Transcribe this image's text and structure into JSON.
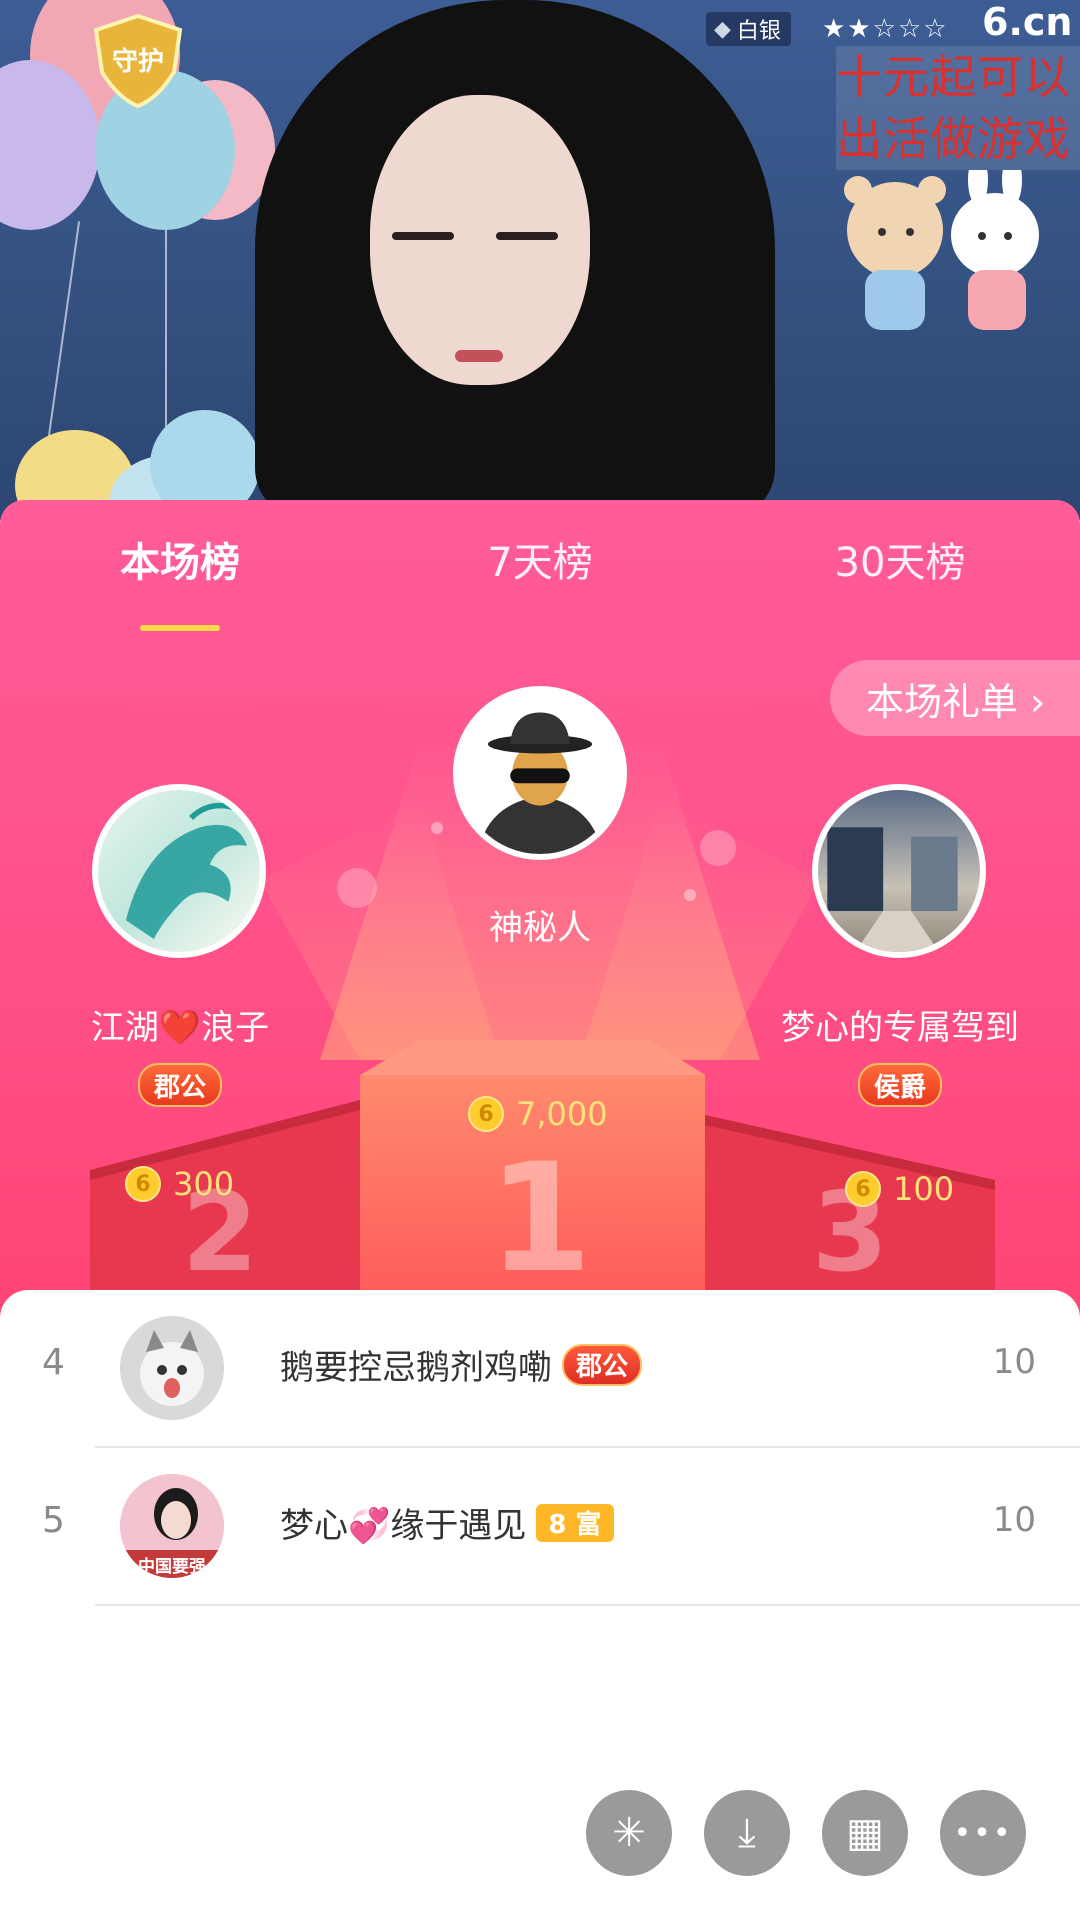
{
  "stream": {
    "guard_badge": "守护",
    "rank_label": "白银",
    "stars": "★★☆☆☆",
    "site_logo": "6.cn",
    "promo_line1": "十元起可以",
    "promo_line2": "出活做游戏"
  },
  "tabs": [
    {
      "label": "本场榜",
      "active": true
    },
    {
      "label": "7天榜",
      "active": false
    },
    {
      "label": "30天榜",
      "active": false
    }
  ],
  "gift_list_button": "本场礼单 ›",
  "podium": {
    "first": {
      "name": "神秘人",
      "score": "7,000",
      "number": "1"
    },
    "second": {
      "name": "江湖❤️浪子",
      "badge": "郡公",
      "score": "300",
      "number": "2"
    },
    "third": {
      "name": "梦心的专属驾到",
      "badge": "侯爵",
      "score": "100",
      "number": "3"
    }
  },
  "coin_glyph": "6",
  "list": [
    {
      "rank": "4",
      "name": "鹅要控忌鹅剂鸡嘞",
      "badge": "郡公",
      "badge_style": "red",
      "score": "10"
    },
    {
      "rank": "5",
      "name": "梦心💞缘于遇见",
      "badge": "8 富",
      "badge_style": "yellow",
      "score": "10",
      "avatar_text": "中国要强"
    }
  ],
  "fabs": [
    {
      "name": "share-icon",
      "glyph": "✳"
    },
    {
      "name": "download-icon",
      "glyph": "⤓"
    },
    {
      "name": "grid-icon",
      "glyph": "▦"
    },
    {
      "name": "more-icon",
      "glyph": "•••"
    }
  ],
  "colors": {
    "accent": "#ff4f86",
    "tab_underline": "#ffd84a",
    "coin": "#ffcc2e"
  }
}
